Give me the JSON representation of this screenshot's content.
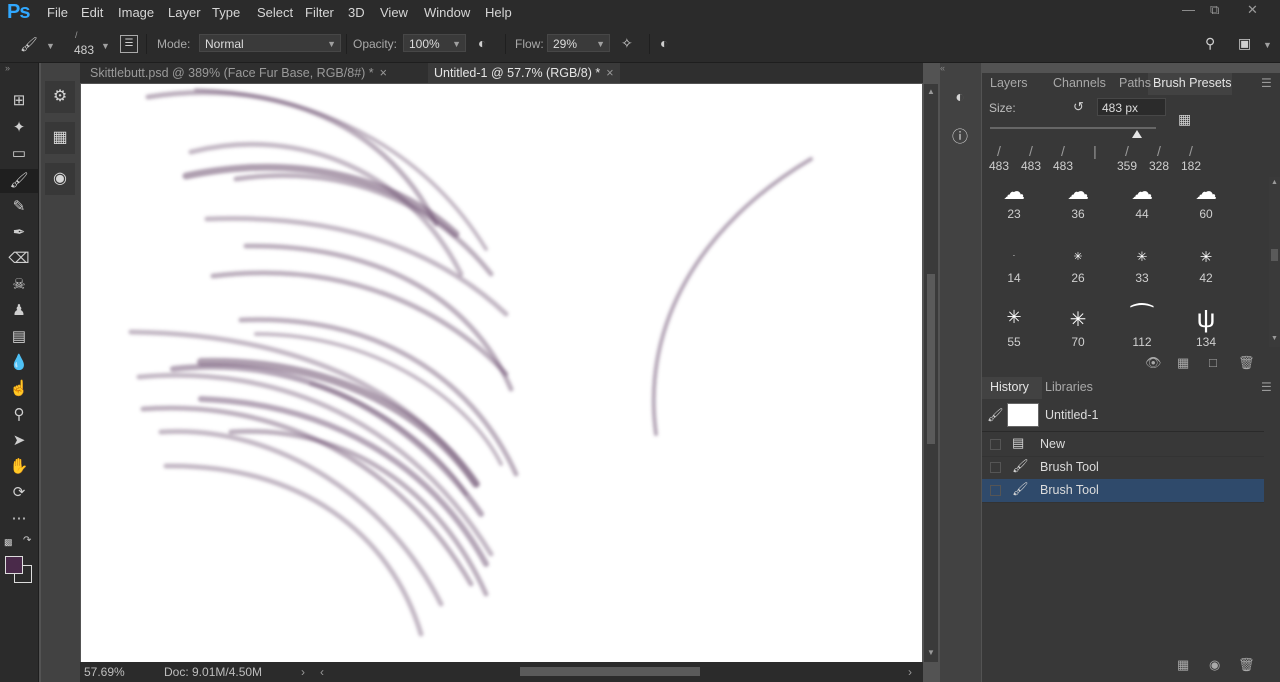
{
  "menubar": {
    "logo": "Ps",
    "items": [
      "File",
      "Edit",
      "Image",
      "Layer",
      "Type",
      "Select",
      "Filter",
      "3D",
      "View",
      "Window",
      "Help"
    ]
  },
  "options": {
    "brush_size": "483",
    "mode_label": "Mode:",
    "mode_value": "Normal",
    "opacity_label": "Opacity:",
    "opacity_value": "100%",
    "flow_label": "Flow:",
    "flow_value": "29%"
  },
  "tabs": [
    {
      "label": "Skittlebutt.psd @ 389% (Face Fur Base, RGB/8#) *",
      "close": "×"
    },
    {
      "label": "Untitled-1 @ 57.7% (RGB/8) *",
      "close": "×"
    }
  ],
  "status": {
    "zoom": "57.69%",
    "doc": "Doc: 9.01M/4.50M"
  },
  "brush_panel": {
    "tabs": [
      "Layers",
      "Channels",
      "Paths",
      "Brush Presets"
    ],
    "size_label": "Size:",
    "size_value": "483 px",
    "recent": [
      "483",
      "483",
      "483",
      "",
      "359",
      "328",
      "182"
    ],
    "grid": [
      "23",
      "36",
      "44",
      "60",
      "14",
      "26",
      "33",
      "42",
      "55",
      "70",
      "112",
      "134"
    ]
  },
  "history_panel": {
    "tabs": [
      "History",
      "Libraries"
    ],
    "snapshot": "Untitled-1",
    "rows": [
      "New",
      "Brush Tool",
      "Brush Tool"
    ]
  },
  "colors": {
    "foreground": "#4a2a4a",
    "background": "#ffffff",
    "accent": "#31a8ff",
    "selection": "#2f4a6b"
  }
}
